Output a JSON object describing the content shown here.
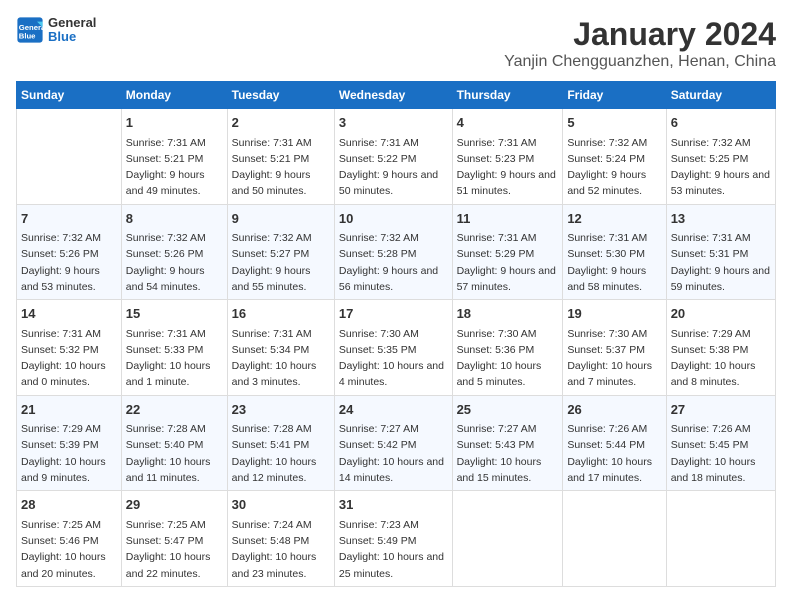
{
  "header": {
    "logo_line1": "General",
    "logo_line2": "Blue",
    "month": "January 2024",
    "location": "Yanjin Chengguanzhen, Henan, China"
  },
  "days_of_week": [
    "Sunday",
    "Monday",
    "Tuesday",
    "Wednesday",
    "Thursday",
    "Friday",
    "Saturday"
  ],
  "weeks": [
    [
      {
        "day": "",
        "sunrise": "",
        "sunset": "",
        "daylight": ""
      },
      {
        "day": "1",
        "sunrise": "Sunrise: 7:31 AM",
        "sunset": "Sunset: 5:21 PM",
        "daylight": "Daylight: 9 hours and 49 minutes."
      },
      {
        "day": "2",
        "sunrise": "Sunrise: 7:31 AM",
        "sunset": "Sunset: 5:21 PM",
        "daylight": "Daylight: 9 hours and 50 minutes."
      },
      {
        "day": "3",
        "sunrise": "Sunrise: 7:31 AM",
        "sunset": "Sunset: 5:22 PM",
        "daylight": "Daylight: 9 hours and 50 minutes."
      },
      {
        "day": "4",
        "sunrise": "Sunrise: 7:31 AM",
        "sunset": "Sunset: 5:23 PM",
        "daylight": "Daylight: 9 hours and 51 minutes."
      },
      {
        "day": "5",
        "sunrise": "Sunrise: 7:32 AM",
        "sunset": "Sunset: 5:24 PM",
        "daylight": "Daylight: 9 hours and 52 minutes."
      },
      {
        "day": "6",
        "sunrise": "Sunrise: 7:32 AM",
        "sunset": "Sunset: 5:25 PM",
        "daylight": "Daylight: 9 hours and 53 minutes."
      }
    ],
    [
      {
        "day": "7",
        "sunrise": "Sunrise: 7:32 AM",
        "sunset": "Sunset: 5:26 PM",
        "daylight": "Daylight: 9 hours and 53 minutes."
      },
      {
        "day": "8",
        "sunrise": "Sunrise: 7:32 AM",
        "sunset": "Sunset: 5:26 PM",
        "daylight": "Daylight: 9 hours and 54 minutes."
      },
      {
        "day": "9",
        "sunrise": "Sunrise: 7:32 AM",
        "sunset": "Sunset: 5:27 PM",
        "daylight": "Daylight: 9 hours and 55 minutes."
      },
      {
        "day": "10",
        "sunrise": "Sunrise: 7:32 AM",
        "sunset": "Sunset: 5:28 PM",
        "daylight": "Daylight: 9 hours and 56 minutes."
      },
      {
        "day": "11",
        "sunrise": "Sunrise: 7:31 AM",
        "sunset": "Sunset: 5:29 PM",
        "daylight": "Daylight: 9 hours and 57 minutes."
      },
      {
        "day": "12",
        "sunrise": "Sunrise: 7:31 AM",
        "sunset": "Sunset: 5:30 PM",
        "daylight": "Daylight: 9 hours and 58 minutes."
      },
      {
        "day": "13",
        "sunrise": "Sunrise: 7:31 AM",
        "sunset": "Sunset: 5:31 PM",
        "daylight": "Daylight: 9 hours and 59 minutes."
      }
    ],
    [
      {
        "day": "14",
        "sunrise": "Sunrise: 7:31 AM",
        "sunset": "Sunset: 5:32 PM",
        "daylight": "Daylight: 10 hours and 0 minutes."
      },
      {
        "day": "15",
        "sunrise": "Sunrise: 7:31 AM",
        "sunset": "Sunset: 5:33 PM",
        "daylight": "Daylight: 10 hours and 1 minute."
      },
      {
        "day": "16",
        "sunrise": "Sunrise: 7:31 AM",
        "sunset": "Sunset: 5:34 PM",
        "daylight": "Daylight: 10 hours and 3 minutes."
      },
      {
        "day": "17",
        "sunrise": "Sunrise: 7:30 AM",
        "sunset": "Sunset: 5:35 PM",
        "daylight": "Daylight: 10 hours and 4 minutes."
      },
      {
        "day": "18",
        "sunrise": "Sunrise: 7:30 AM",
        "sunset": "Sunset: 5:36 PM",
        "daylight": "Daylight: 10 hours and 5 minutes."
      },
      {
        "day": "19",
        "sunrise": "Sunrise: 7:30 AM",
        "sunset": "Sunset: 5:37 PM",
        "daylight": "Daylight: 10 hours and 7 minutes."
      },
      {
        "day": "20",
        "sunrise": "Sunrise: 7:29 AM",
        "sunset": "Sunset: 5:38 PM",
        "daylight": "Daylight: 10 hours and 8 minutes."
      }
    ],
    [
      {
        "day": "21",
        "sunrise": "Sunrise: 7:29 AM",
        "sunset": "Sunset: 5:39 PM",
        "daylight": "Daylight: 10 hours and 9 minutes."
      },
      {
        "day": "22",
        "sunrise": "Sunrise: 7:28 AM",
        "sunset": "Sunset: 5:40 PM",
        "daylight": "Daylight: 10 hours and 11 minutes."
      },
      {
        "day": "23",
        "sunrise": "Sunrise: 7:28 AM",
        "sunset": "Sunset: 5:41 PM",
        "daylight": "Daylight: 10 hours and 12 minutes."
      },
      {
        "day": "24",
        "sunrise": "Sunrise: 7:27 AM",
        "sunset": "Sunset: 5:42 PM",
        "daylight": "Daylight: 10 hours and 14 minutes."
      },
      {
        "day": "25",
        "sunrise": "Sunrise: 7:27 AM",
        "sunset": "Sunset: 5:43 PM",
        "daylight": "Daylight: 10 hours and 15 minutes."
      },
      {
        "day": "26",
        "sunrise": "Sunrise: 7:26 AM",
        "sunset": "Sunset: 5:44 PM",
        "daylight": "Daylight: 10 hours and 17 minutes."
      },
      {
        "day": "27",
        "sunrise": "Sunrise: 7:26 AM",
        "sunset": "Sunset: 5:45 PM",
        "daylight": "Daylight: 10 hours and 18 minutes."
      }
    ],
    [
      {
        "day": "28",
        "sunrise": "Sunrise: 7:25 AM",
        "sunset": "Sunset: 5:46 PM",
        "daylight": "Daylight: 10 hours and 20 minutes."
      },
      {
        "day": "29",
        "sunrise": "Sunrise: 7:25 AM",
        "sunset": "Sunset: 5:47 PM",
        "daylight": "Daylight: 10 hours and 22 minutes."
      },
      {
        "day": "30",
        "sunrise": "Sunrise: 7:24 AM",
        "sunset": "Sunset: 5:48 PM",
        "daylight": "Daylight: 10 hours and 23 minutes."
      },
      {
        "day": "31",
        "sunrise": "Sunrise: 7:23 AM",
        "sunset": "Sunset: 5:49 PM",
        "daylight": "Daylight: 10 hours and 25 minutes."
      },
      {
        "day": "",
        "sunrise": "",
        "sunset": "",
        "daylight": ""
      },
      {
        "day": "",
        "sunrise": "",
        "sunset": "",
        "daylight": ""
      },
      {
        "day": "",
        "sunrise": "",
        "sunset": "",
        "daylight": ""
      }
    ]
  ]
}
